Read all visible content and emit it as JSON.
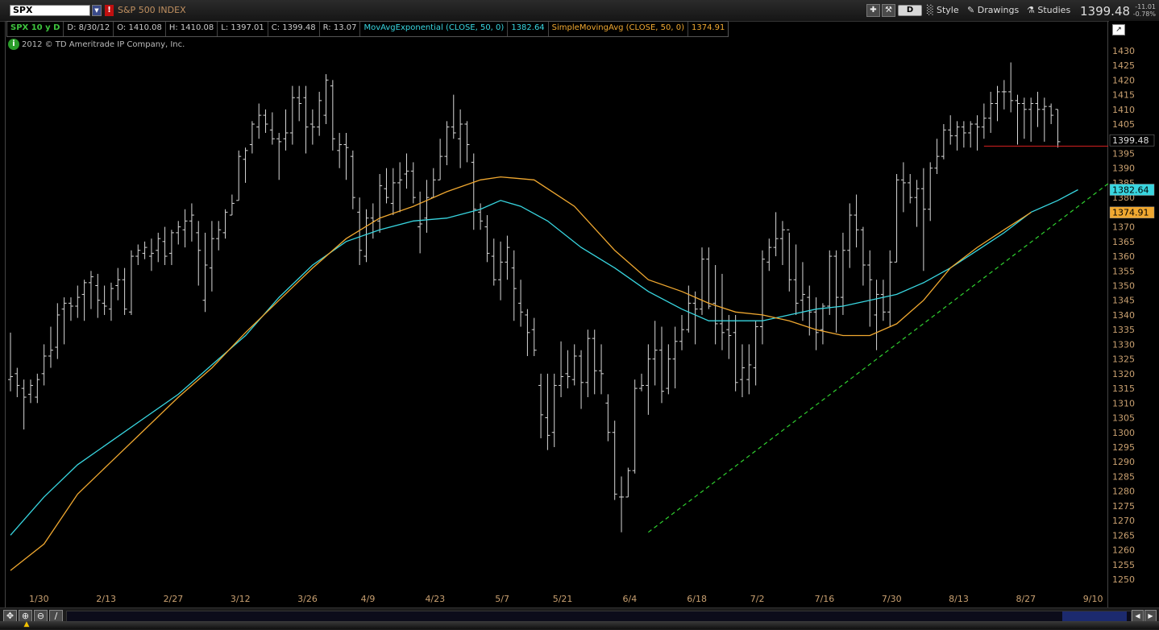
{
  "toolbar": {
    "symbol": "SPX",
    "index_name": "S&P 500 INDEX",
    "period": "D",
    "style_label": "Style",
    "drawings_label": "Drawings",
    "studies_label": "Studies",
    "last_price": "1399.48",
    "net_change": "-11.01",
    "pct_change": "-0.78%"
  },
  "legend": {
    "symbol_period": "SPX 10 y D",
    "date": "D: 8/30/12",
    "open": "O: 1410.08",
    "high": "H: 1410.08",
    "low": "L: 1397.01",
    "close": "C: 1399.48",
    "range": "R: 13.07",
    "ema_label": "MovAvgExponential (CLOSE, 50, 0)",
    "ema_value": "1382.64",
    "sma_label": "SimpleMovingAvg (CLOSE, 50, 0)",
    "sma_value": "1374.91"
  },
  "copyright": "2012 © TD Ameritrade IP Company, Inc.",
  "colors": {
    "bars": "#d8d8d8",
    "ema": "#38d6e0",
    "sma": "#f0a830",
    "trendline": "#2fd02f",
    "support": "#d82020",
    "axis_text": "#c9a070",
    "legend_green": "#3ec43e",
    "legend_white": "#dddddd"
  },
  "chart_data": {
    "type": "ohlc",
    "interval": "daily",
    "ylim": [
      1245,
      1430
    ],
    "y_ticks": [
      1250,
      1255,
      1260,
      1265,
      1270,
      1275,
      1280,
      1285,
      1290,
      1295,
      1300,
      1305,
      1310,
      1315,
      1320,
      1325,
      1330,
      1335,
      1340,
      1345,
      1350,
      1355,
      1360,
      1365,
      1370,
      1375,
      1380,
      1385,
      1390,
      1395,
      1400,
      1405,
      1410,
      1415,
      1420,
      1425,
      1430
    ],
    "x_ticks": [
      "1/30",
      "2/13",
      "2/27",
      "3/12",
      "3/26",
      "4/9",
      "4/23",
      "5/7",
      "5/21",
      "6/4",
      "6/18",
      "7/2",
      "7/16",
      "7/30",
      "8/13",
      "8/27",
      "9/10"
    ],
    "x_tick_bar_index": [
      4,
      14,
      24,
      34,
      44,
      53,
      63,
      73,
      82,
      92,
      102,
      111,
      121,
      131,
      141,
      151,
      161
    ],
    "bars": [
      [
        1318,
        1334,
        1314,
        1319
      ],
      [
        1320,
        1322,
        1312,
        1316
      ],
      [
        1315,
        1318,
        1301,
        1312
      ],
      [
        1313,
        1318,
        1310,
        1316
      ],
      [
        1312,
        1320,
        1310,
        1318
      ],
      [
        1320,
        1330,
        1316,
        1326
      ],
      [
        1326,
        1336,
        1322,
        1328
      ],
      [
        1329,
        1344,
        1325,
        1340
      ],
      [
        1342,
        1346,
        1330,
        1344
      ],
      [
        1344,
        1346,
        1338,
        1343
      ],
      [
        1343,
        1350,
        1339,
        1346
      ],
      [
        1347,
        1352,
        1338,
        1351
      ],
      [
        1351,
        1355,
        1342,
        1353
      ],
      [
        1350,
        1354,
        1339,
        1345
      ],
      [
        1344,
        1350,
        1340,
        1343
      ],
      [
        1342,
        1351,
        1338,
        1349
      ],
      [
        1350,
        1356,
        1345,
        1352
      ],
      [
        1352,
        1356,
        1340,
        1342
      ],
      [
        1341,
        1362,
        1340,
        1360
      ],
      [
        1360,
        1364,
        1357,
        1362
      ],
      [
        1361,
        1365,
        1359,
        1363
      ],
      [
        1360,
        1366,
        1355,
        1361
      ],
      [
        1362,
        1368,
        1358,
        1366
      ],
      [
        1365,
        1370,
        1357,
        1360
      ],
      [
        1361,
        1369,
        1357,
        1368
      ],
      [
        1368,
        1372,
        1364,
        1370
      ],
      [
        1369,
        1376,
        1363,
        1372
      ],
      [
        1372,
        1378,
        1365,
        1374
      ],
      [
        1368,
        1372,
        1350,
        1362
      ],
      [
        1345,
        1368,
        1341,
        1357
      ],
      [
        1356,
        1372,
        1348,
        1366
      ],
      [
        1366,
        1372,
        1362,
        1369
      ],
      [
        1368,
        1376,
        1366,
        1375
      ],
      [
        1374,
        1381,
        1374,
        1378
      ],
      [
        1379,
        1396,
        1379,
        1394
      ],
      [
        1393,
        1397,
        1385,
        1396
      ],
      [
        1398,
        1406,
        1395,
        1405
      ],
      [
        1404,
        1412,
        1400,
        1408
      ],
      [
        1408,
        1410,
        1402,
        1405
      ],
      [
        1403,
        1409,
        1398,
        1400
      ],
      [
        1400,
        1402,
        1386,
        1399
      ],
      [
        1400,
        1410,
        1396,
        1402
      ],
      [
        1402,
        1418,
        1398,
        1414
      ],
      [
        1414,
        1418,
        1406,
        1412
      ],
      [
        1414,
        1418,
        1395,
        1404
      ],
      [
        1405,
        1410,
        1398,
        1404
      ],
      [
        1404,
        1416,
        1401,
        1413
      ],
      [
        1408,
        1422,
        1405,
        1420
      ],
      [
        1418,
        1420,
        1396,
        1400
      ],
      [
        1396,
        1402,
        1390,
        1398
      ],
      [
        1398,
        1402,
        1386,
        1397
      ],
      [
        1394,
        1396,
        1376,
        1380
      ],
      [
        1375,
        1380,
        1357,
        1362
      ],
      [
        1360,
        1376,
        1358,
        1373
      ],
      [
        1373,
        1378,
        1366,
        1372
      ],
      [
        1372,
        1388,
        1368,
        1384
      ],
      [
        1383,
        1390,
        1378,
        1380
      ],
      [
        1378,
        1390,
        1374,
        1385
      ],
      [
        1385,
        1392,
        1375,
        1386
      ],
      [
        1388,
        1395,
        1383,
        1389
      ],
      [
        1389,
        1392,
        1378,
        1380
      ],
      [
        1370,
        1382,
        1361,
        1371
      ],
      [
        1373,
        1386,
        1368,
        1380
      ],
      [
        1380,
        1390,
        1380,
        1386
      ],
      [
        1386,
        1400,
        1386,
        1394
      ],
      [
        1394,
        1406,
        1391,
        1404
      ],
      [
        1404,
        1415,
        1400,
        1402
      ],
      [
        1400,
        1410,
        1390,
        1405
      ],
      [
        1405,
        1406,
        1392,
        1398
      ],
      [
        1392,
        1395,
        1369,
        1376
      ],
      [
        1375,
        1378,
        1369,
        1372
      ],
      [
        1370,
        1374,
        1358,
        1361
      ],
      [
        1360,
        1366,
        1350,
        1352
      ],
      [
        1352,
        1365,
        1345,
        1358
      ],
      [
        1358,
        1367,
        1352,
        1363
      ],
      [
        1356,
        1362,
        1338,
        1349
      ],
      [
        1344,
        1352,
        1336,
        1341
      ],
      [
        1340,
        1342,
        1326,
        1334
      ],
      [
        1335,
        1339,
        1326,
        1328
      ],
      [
        1316,
        1320,
        1298,
        1306
      ],
      [
        1305,
        1320,
        1294,
        1299
      ],
      [
        1300,
        1320,
        1295,
        1316
      ],
      [
        1316,
        1331,
        1312,
        1319
      ],
      [
        1320,
        1328,
        1315,
        1319
      ],
      [
        1318,
        1330,
        1316,
        1326
      ],
      [
        1326,
        1328,
        1308,
        1317
      ],
      [
        1317,
        1335,
        1312,
        1332
      ],
      [
        1332,
        1335,
        1313,
        1321
      ],
      [
        1321,
        1330,
        1313,
        1320
      ],
      [
        1310,
        1313,
        1297,
        1300
      ],
      [
        1300,
        1304,
        1277,
        1279
      ],
      [
        1278,
        1285,
        1266,
        1278
      ],
      [
        1278,
        1288,
        1278,
        1287
      ],
      [
        1287,
        1318,
        1286,
        1315
      ],
      [
        1315,
        1320,
        1314,
        1316
      ],
      [
        1316,
        1330,
        1306,
        1325
      ],
      [
        1325,
        1338,
        1316,
        1328
      ],
      [
        1328,
        1336,
        1310,
        1314
      ],
      [
        1315,
        1330,
        1313,
        1325
      ],
      [
        1325,
        1336,
        1315,
        1331
      ],
      [
        1331,
        1340,
        1328,
        1335
      ],
      [
        1335,
        1350,
        1334,
        1344
      ],
      [
        1344,
        1348,
        1330,
        1342
      ],
      [
        1342,
        1363,
        1340,
        1359
      ],
      [
        1359,
        1363,
        1342,
        1343
      ],
      [
        1344,
        1357,
        1330,
        1337
      ],
      [
        1337,
        1354,
        1328,
        1334
      ],
      [
        1335,
        1340,
        1325,
        1333
      ],
      [
        1334,
        1340,
        1314,
        1317
      ],
      [
        1318,
        1330,
        1312,
        1322
      ],
      [
        1318,
        1330,
        1313,
        1323
      ],
      [
        1322,
        1338,
        1316,
        1336
      ],
      [
        1336,
        1362,
        1330,
        1359
      ],
      [
        1358,
        1366,
        1355,
        1363
      ],
      [
        1363,
        1375,
        1360,
        1366
      ],
      [
        1366,
        1372,
        1357,
        1369
      ],
      [
        1369,
        1368,
        1348,
        1352
      ],
      [
        1352,
        1364,
        1340,
        1344
      ],
      [
        1345,
        1358,
        1338,
        1347
      ],
      [
        1346,
        1350,
        1333,
        1341
      ],
      [
        1341,
        1346,
        1328,
        1334
      ],
      [
        1335,
        1344,
        1330,
        1343
      ],
      [
        1343,
        1362,
        1340,
        1360
      ],
      [
        1360,
        1362,
        1334,
        1346
      ],
      [
        1346,
        1368,
        1340,
        1362
      ],
      [
        1362,
        1378,
        1356,
        1374
      ],
      [
        1374,
        1381,
        1363,
        1369
      ],
      [
        1369,
        1370,
        1350,
        1357
      ],
      [
        1357,
        1362,
        1336,
        1352
      ],
      [
        1340,
        1352,
        1328,
        1347
      ],
      [
        1347,
        1352,
        1338,
        1341
      ],
      [
        1341,
        1362,
        1336,
        1358
      ],
      [
        1358,
        1388,
        1358,
        1386
      ],
      [
        1386,
        1392,
        1375,
        1385
      ],
      [
        1385,
        1388,
        1378,
        1380
      ],
      [
        1380,
        1386,
        1370,
        1383
      ],
      [
        1383,
        1390,
        1355,
        1376
      ],
      [
        1376,
        1392,
        1372,
        1390
      ],
      [
        1390,
        1400,
        1388,
        1394
      ],
      [
        1394,
        1405,
        1393,
        1403
      ],
      [
        1403,
        1408,
        1398,
        1401
      ],
      [
        1401,
        1406,
        1396,
        1404
      ],
      [
        1404,
        1406,
        1397,
        1402
      ],
      [
        1402,
        1406,
        1397,
        1405
      ],
      [
        1405,
        1408,
        1396,
        1404
      ],
      [
        1404,
        1412,
        1400,
        1407
      ],
      [
        1407,
        1416,
        1402,
        1412
      ],
      [
        1412,
        1418,
        1406,
        1416
      ],
      [
        1416,
        1420,
        1410,
        1416
      ],
      [
        1416,
        1426,
        1409,
        1413
      ],
      [
        1413,
        1415,
        1398,
        1412
      ],
      [
        1412,
        1414,
        1400,
        1410
      ],
      [
        1410,
        1414,
        1399,
        1412
      ],
      [
        1412,
        1416,
        1404,
        1410
      ],
      [
        1410,
        1414,
        1399,
        1411
      ],
      [
        1411,
        1412,
        1405,
        1408
      ],
      [
        1410,
        1410,
        1397,
        1399
      ]
    ],
    "series": [
      {
        "name": "MovAvgExponential (CLOSE, 50, 0)",
        "last_value": 1382.64,
        "points": [
          [
            0,
            1265
          ],
          [
            5,
            1278
          ],
          [
            10,
            1289
          ],
          [
            15,
            1297
          ],
          [
            20,
            1305
          ],
          [
            25,
            1313
          ],
          [
            30,
            1323
          ],
          [
            35,
            1333
          ],
          [
            40,
            1346
          ],
          [
            45,
            1357
          ],
          [
            50,
            1365
          ],
          [
            55,
            1369
          ],
          [
            60,
            1372
          ],
          [
            65,
            1373
          ],
          [
            70,
            1376
          ],
          [
            73,
            1379
          ],
          [
            76,
            1377
          ],
          [
            80,
            1372
          ],
          [
            85,
            1363
          ],
          [
            90,
            1356
          ],
          [
            95,
            1348
          ],
          [
            100,
            1342
          ],
          [
            104,
            1338
          ],
          [
            108,
            1338
          ],
          [
            112,
            1338
          ],
          [
            116,
            1340
          ],
          [
            120,
            1342
          ],
          [
            124,
            1343
          ],
          [
            128,
            1345
          ],
          [
            132,
            1347
          ],
          [
            136,
            1351
          ],
          [
            140,
            1356
          ],
          [
            144,
            1362
          ],
          [
            148,
            1368
          ],
          [
            152,
            1375
          ],
          [
            156,
            1379
          ],
          [
            159,
            1382.64
          ]
        ]
      },
      {
        "name": "SimpleMovingAvg (CLOSE, 50, 0)",
        "last_value": 1374.91,
        "points": [
          [
            0,
            1253
          ],
          [
            5,
            1262
          ],
          [
            10,
            1279
          ],
          [
            15,
            1290
          ],
          [
            20,
            1301
          ],
          [
            25,
            1312
          ],
          [
            30,
            1322
          ],
          [
            35,
            1334
          ],
          [
            40,
            1345
          ],
          [
            45,
            1356
          ],
          [
            50,
            1366
          ],
          [
            55,
            1373
          ],
          [
            60,
            1377
          ],
          [
            65,
            1382
          ],
          [
            70,
            1386
          ],
          [
            73,
            1387
          ],
          [
            78,
            1386
          ],
          [
            84,
            1377
          ],
          [
            90,
            1362
          ],
          [
            95,
            1352
          ],
          [
            100,
            1348
          ],
          [
            104,
            1344
          ],
          [
            108,
            1341
          ],
          [
            112,
            1340
          ],
          [
            116,
            1338
          ],
          [
            120,
            1335
          ],
          [
            124,
            1333
          ],
          [
            128,
            1333
          ],
          [
            132,
            1337
          ],
          [
            136,
            1345
          ],
          [
            140,
            1356
          ],
          [
            144,
            1363
          ],
          [
            148,
            1369
          ],
          [
            152,
            1374.91
          ]
        ]
      }
    ],
    "trendline": {
      "from": [
        95,
        1266
      ],
      "to": [
        170,
        1396
      ]
    },
    "support_line": {
      "from": [
        145,
        1397.5
      ],
      "to": [
        170,
        1397.5
      ]
    }
  }
}
